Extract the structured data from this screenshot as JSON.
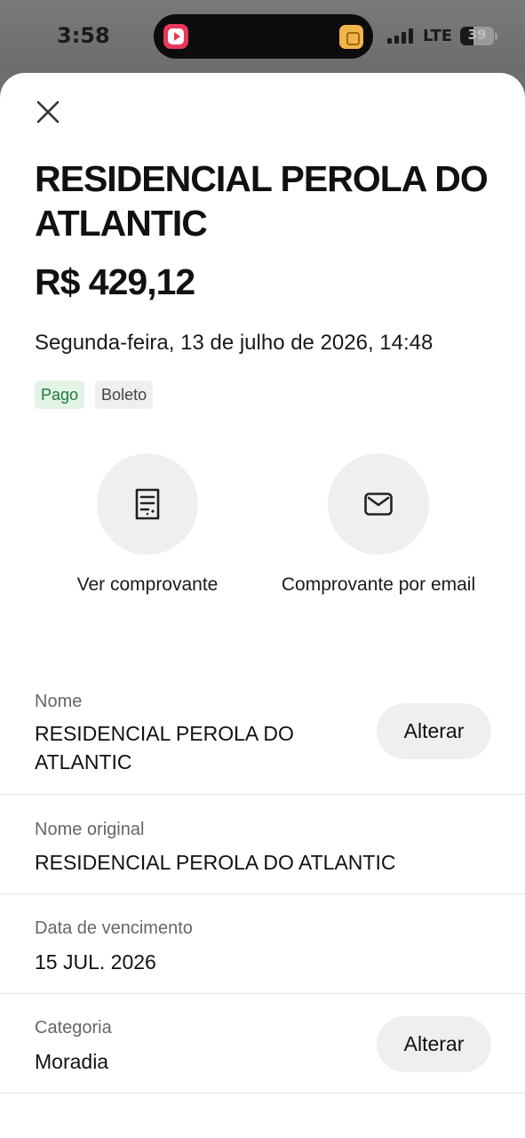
{
  "status_bar": {
    "time": "3:58",
    "network": "LTE",
    "battery": "39",
    "battery_level": 0.39
  },
  "transaction": {
    "title": "RESIDENCIAL PEROLA DO ATLANTIC",
    "amount": "R$ 429,12",
    "datetime": "Segunda-feira, 13 de julho de 2026, 14:48",
    "status_badge": "Pago",
    "type_badge": "Boleto"
  },
  "actions": {
    "receipt_label": "Ver comprovante",
    "email_label": "Comprovante por email"
  },
  "details": {
    "name_label": "Nome",
    "name_value": "RESIDENCIAL PEROLA DO ATLANTIC",
    "original_name_label": "Nome original",
    "original_name_value": "RESIDENCIAL PEROLA DO ATLANTIC",
    "due_date_label": "Data de vencimento",
    "due_date_value": "15 JUL. 2026",
    "category_label": "Categoria",
    "category_value": "Moradia",
    "change_label": "Alterar"
  },
  "colors": {
    "paid_badge_bg": "#e2f4e6",
    "paid_badge_text": "#1e7a3d"
  },
  "icons": {
    "close": "close-icon",
    "receipt": "receipt-icon",
    "email": "envelope-icon"
  }
}
